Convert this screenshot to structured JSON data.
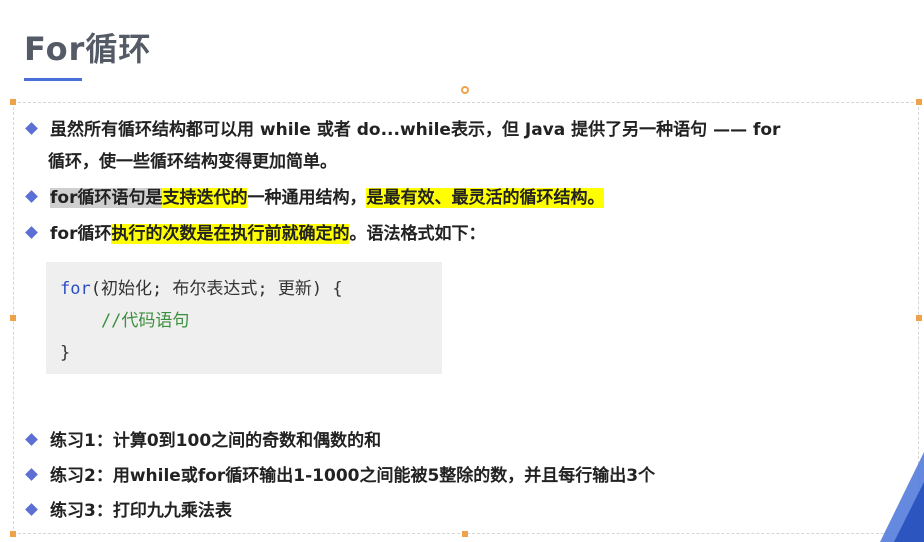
{
  "slide": {
    "title": "For循环"
  },
  "bullets": [
    {
      "line1": "虽然所有循环结构都可以用 while 或者 do...while表示，但 Java 提供了另一种语句 —— for",
      "line2": "循环，使一些循环结构变得更加简单。"
    },
    {
      "part_gray": "for循环语句是",
      "part_yellow1": "支持迭代的",
      "part_plain": "一种通用结构，",
      "part_yellow2": "是最有效、最灵活的循环结构。"
    },
    {
      "part_plain1": "for循环",
      "part_yellow": "执行的次数是在执行前就确定的",
      "part_plain2": "。语法格式如下："
    }
  ],
  "code": {
    "keyword": "for",
    "line1_rest": "(初始化; 布尔表达式; 更新) {",
    "line2": "    //代码语句",
    "line3": "}"
  },
  "exercises": [
    "练习1：计算0到100之间的奇数和偶数的和",
    "练习2：用while或for循环输出1-1000之间能被5整除的数，并且每行输出3个",
    "练习3：打印九九乘法表"
  ],
  "colors": {
    "bullet": "#5b6fd6",
    "highlight": "#ffff00",
    "title_underline": "#4a6fd8",
    "selection_handle": "#f0a24a"
  }
}
